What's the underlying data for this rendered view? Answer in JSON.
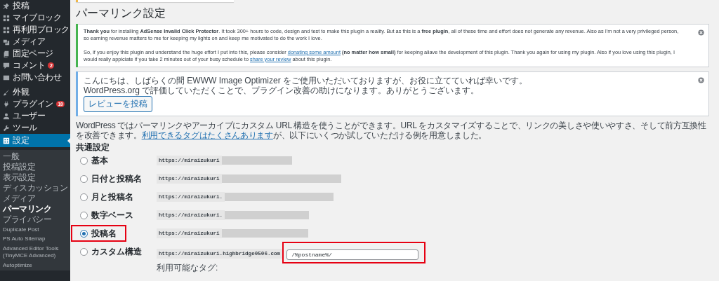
{
  "sidebar": {
    "groups": [
      {
        "items": [
          {
            "label": "投稿",
            "selected": false
          },
          {
            "label": "マイブロック",
            "selected": false
          },
          {
            "label": "再利用ブロック",
            "selected": false
          },
          {
            "label": "メディア",
            "selected": false
          },
          {
            "label": "固定ページ",
            "selected": false
          },
          {
            "label": "コメント",
            "badge": "2",
            "selected": false
          },
          {
            "label": "お問い合わせ",
            "selected": false
          }
        ]
      },
      {
        "items": [
          {
            "label": "外観",
            "selected": false
          },
          {
            "label": "プラグイン",
            "badge": "10",
            "selected": false
          },
          {
            "label": "ユーザー",
            "selected": false
          },
          {
            "label": "ツール",
            "selected": false
          },
          {
            "label": "設定",
            "selected": true
          }
        ]
      }
    ],
    "submenu": [
      {
        "label": "一般",
        "selected": false
      },
      {
        "label": "投稿設定",
        "selected": false
      },
      {
        "label": "表示設定",
        "selected": false
      },
      {
        "label": "ディスカッション",
        "selected": false
      },
      {
        "label": "メディア",
        "selected": false
      },
      {
        "label": "パーマリンク",
        "selected": true
      },
      {
        "label": "プライバシー",
        "selected": false
      },
      {
        "label": "Duplicate Post",
        "selected": false
      },
      {
        "label": "PS Auto Sitemap",
        "selected": false
      },
      {
        "label": "Advanced Editor Tools (TinyMCE Advanced)",
        "selected": false
      },
      {
        "label": "Autoptimize",
        "selected": false
      }
    ]
  },
  "page_title": "パーマリンク設定",
  "notices": [
    {
      "color": "#46b450",
      "paragraphs": [
        [
          {
            "kind": "text",
            "text": "**Thank you** for installing **AdSense Invalid Click Protector**. It took 300+ hours to code, design and test to make this plugin a reality. But as this is a **free plugin**, all of these time and effort does not generate any revenue. Also as I'm not a very privileged person, so earning revenue matters to me for keeping my lights on and keep me motivated to do the work I love."
          }
        ],
        [
          {
            "kind": "text",
            "text": "So, if you enjoy this plugin and understand the huge effort I put into this, please consider "
          },
          {
            "kind": "link",
            "text": "donating some amount"
          },
          {
            "kind": "text",
            "text": " **(no matter how small)** for keeping aliave the development of this plugin. Thank you again for using my plugin. Also if you love using this plugin, I would really appiciate if you take 2 minutes out of your busy schedule to "
          },
          {
            "kind": "link",
            "text": "share your review"
          },
          {
            "kind": "text",
            "text": " about this plugin."
          }
        ]
      ]
    },
    {
      "color": "#72aee6",
      "paragraphs": [
        [
          {
            "kind": "text",
            "text": "こんにちは、しばらくの間 EWWW Image Optimizer をご使用いただいておりますが、お役に立てていれば幸いです。"
          }
        ],
        [
          {
            "kind": "text",
            "text": "WordPress.org で評価していただくことで、プラグイン改善の助けになります。ありがとうございます。"
          }
        ]
      ],
      "button": "レビューを投稿"
    }
  ],
  "intro": [
    {
      "kind": "text",
      "text": "WordPress ではパーマリンクやアーカイブにカスタム URL 構造を使うことができます。URL をカスタマイズすることで、リンクの美しさや使いやすさ、そして前方互換性を改善できます。"
    },
    {
      "kind": "link",
      "text": "利用できるタグはたくさんあります"
    },
    {
      "kind": "text",
      "text": "が、以下にいくつか試していただける例を用意しました。"
    }
  ],
  "section_title": "共通設定",
  "options": [
    {
      "kind": "preset",
      "label": "基本",
      "selected": false,
      "highlighted": false,
      "url": "https://miraizukuri"
    },
    {
      "kind": "preset",
      "label": "日付と投稿名",
      "selected": false,
      "highlighted": false,
      "url": "https://miraizukuri"
    },
    {
      "kind": "preset",
      "label": "月と投稿名",
      "selected": false,
      "highlighted": false,
      "url": "https://miraizukuri."
    },
    {
      "kind": "preset",
      "label": "数字ベース",
      "selected": false,
      "highlighted": false,
      "url": "https://miraizukuri."
    },
    {
      "kind": "preset",
      "label": "投稿名",
      "selected": true,
      "highlighted": true,
      "url": "https://miraizukuri"
    },
    {
      "kind": "custom",
      "label": "カスタム構造",
      "selected": false,
      "highlighted": false,
      "url": "https://miraizukuri.highbridge0506.com",
      "value": "/%postname%/",
      "field_highlighted": true,
      "tags_label": "利用可能なタグ:"
    }
  ]
}
